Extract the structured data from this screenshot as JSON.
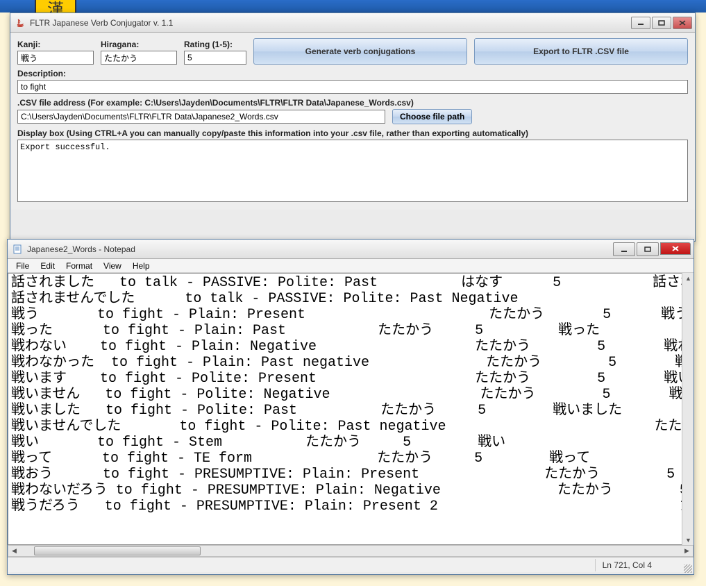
{
  "conjugator": {
    "title": "FLTR Japanese Verb Conjugator v. 1.1",
    "labels": {
      "kanji": "Kanji:",
      "hiragana": "Hiragana:",
      "rating": "Rating (1-5):",
      "description": "Description:",
      "csv_addr": ".CSV file address (For example: C:\\Users\\Jayden\\Documents\\FLTR\\FLTR Data\\Japanese_Words.csv)",
      "display_box": "Display box (Using CTRL+A you can manually copy/paste this information into your .csv file, rather than exporting automatically)"
    },
    "values": {
      "kanji": "戦う",
      "hiragana": "たたかう",
      "rating": "5",
      "description": "to fight",
      "csv_path": "C:\\Users\\Jayden\\Documents\\FLTR\\FLTR Data\\Japanese2_Words.csv",
      "display": "Export successful."
    },
    "buttons": {
      "generate": "Generate verb conjugations",
      "export": "Export to FLTR .CSV file",
      "choose_path": "Choose file path"
    }
  },
  "notepad": {
    "title": "Japanese2_Words - Notepad",
    "menu": [
      "File",
      "Edit",
      "Format",
      "View",
      "Help"
    ],
    "status": "Ln 721, Col 4",
    "content": "話されました   to talk - PASSIVE: Polite: Past          はなす      5           話されま\n話されませんでした      to talk - PASSIVE: Polite: Past Negative\n戦う       to fight - Plain: Present                      たたかう       5      戦う\n戦った      to fight - Plain: Past           たたかう     5         戦った\n戦わない    to fight - Plain: Negative                   たたかう        5       戦わない\n戦わなかった  to fight - Plain: Past negative              たたかう        5       戦わなた\n戦います    to fight - Polite: Present                   たたかう        5       戦います\n戦いません   to fight - Polite: Negative                  たたかう        5       戦いませ\n戦いました   to fight - Polite: Past          たたかう     5        戦いました\n戦いませんでした       to fight - Polite: Past negative                         たたかう\n戦い       to fight - Stem          たたかう     5        戦い\n戦って      to fight - TE form               たたかう     5        戦って\n戦おう      to fight - PRESUMPTIVE: Plain: Present               たたかう        5\n戦わないだろう to fight - PRESUMPTIVE: Plain: Negative              たたかう        5\n戦うだろう   to fight - PRESUMPTIVE: Plain: Present 2                             たたかう"
  }
}
